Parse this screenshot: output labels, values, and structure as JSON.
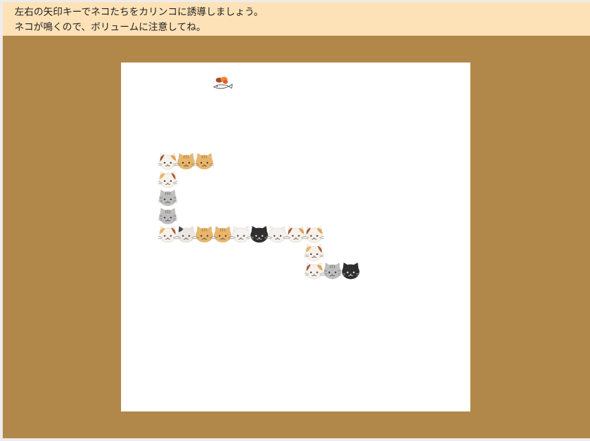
{
  "instructions": {
    "line1": "左右の矢印キーでネコたちをカリンコに誘導しましょう。",
    "line2": "ネコが鳴くので、ボリュームに注意してね。"
  },
  "colors": {
    "banner_bg": "#fde2b8",
    "stage_bg": "#b1884a",
    "board_bg": "#ffffff"
  },
  "game": {
    "karinko_item": {
      "icon": "karinko-fish-treat-icon",
      "cell": [
        5,
        1
      ]
    },
    "cat_types": {
      "calico-a": {
        "base": "#f7f1ea",
        "patches": [
          "#e0a65a",
          "#9b5a3a"
        ]
      },
      "calico-b": {
        "base": "#f7f1ea",
        "patches": [
          "#e8b462",
          "#a4603c"
        ]
      },
      "ginger": {
        "base": "#e8b56a",
        "patches": [
          "#c98e3f"
        ]
      },
      "gray": {
        "base": "#bdbdbd",
        "patches": [
          "#8f8f8f"
        ]
      },
      "white": {
        "base": "#f5f2ee",
        "patches": []
      },
      "black": {
        "base": "#2f2f2f",
        "patches": []
      },
      "siamese": {
        "base": "#ece7e0",
        "patches": [
          "#444444"
        ]
      }
    },
    "cats": [
      {
        "type": "calico-a",
        "cell": [
          2,
          5
        ]
      },
      {
        "type": "ginger",
        "cell": [
          3,
          5
        ]
      },
      {
        "type": "ginger",
        "cell": [
          4,
          5
        ]
      },
      {
        "type": "calico-b",
        "cell": [
          2,
          6
        ]
      },
      {
        "type": "gray",
        "cell": [
          2,
          7
        ]
      },
      {
        "type": "gray",
        "cell": [
          2,
          8
        ]
      },
      {
        "type": "calico-b",
        "cell": [
          2,
          9
        ]
      },
      {
        "type": "siamese",
        "cell": [
          3,
          9
        ]
      },
      {
        "type": "ginger",
        "cell": [
          4,
          9
        ]
      },
      {
        "type": "ginger",
        "cell": [
          5,
          9
        ]
      },
      {
        "type": "white",
        "cell": [
          6,
          9
        ]
      },
      {
        "type": "black",
        "cell": [
          7,
          9
        ]
      },
      {
        "type": "white",
        "cell": [
          8,
          9
        ]
      },
      {
        "type": "calico-a",
        "cell": [
          9,
          9
        ]
      },
      {
        "type": "calico-a",
        "cell": [
          10,
          9
        ]
      },
      {
        "type": "calico-b",
        "cell": [
          10,
          10
        ]
      },
      {
        "type": "calico-a",
        "cell": [
          10,
          11
        ]
      },
      {
        "type": "gray",
        "cell": [
          11,
          11
        ]
      },
      {
        "type": "black",
        "cell": [
          12,
          11
        ]
      }
    ]
  }
}
